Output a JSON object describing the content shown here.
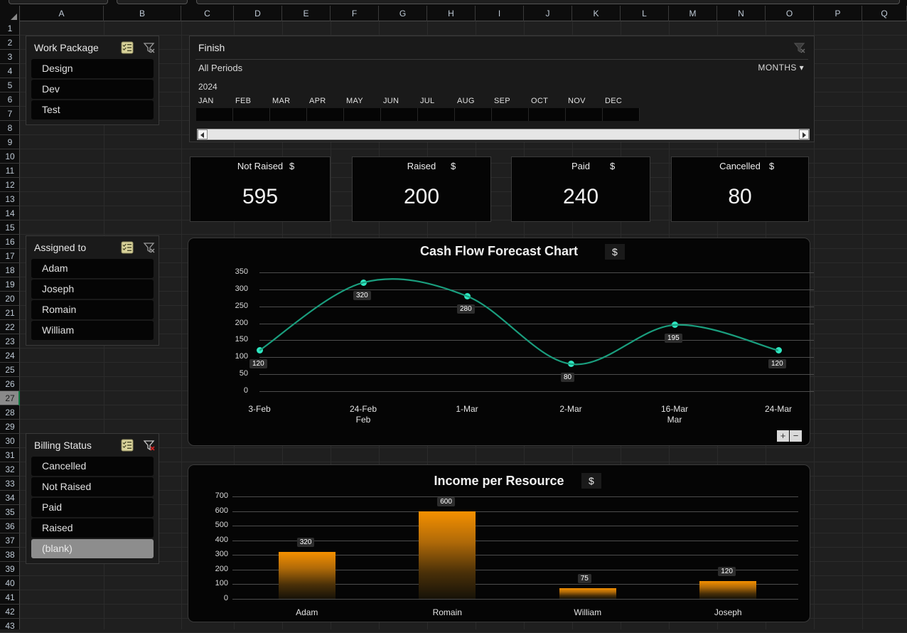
{
  "grid": {
    "columns": [
      "A",
      "B",
      "C",
      "D",
      "E",
      "F",
      "G",
      "H",
      "I",
      "J",
      "K",
      "L",
      "M",
      "N",
      "O",
      "P",
      "Q"
    ],
    "rows": [
      1,
      2,
      3,
      4,
      5,
      6,
      7,
      8,
      9,
      10,
      11,
      12,
      13,
      14,
      15,
      16,
      17,
      18,
      19,
      20,
      21,
      22,
      23,
      24,
      25,
      26,
      27,
      28,
      29,
      30,
      31,
      32,
      33,
      34,
      35,
      36,
      37,
      38,
      39,
      40,
      41,
      42,
      43
    ],
    "active_row": 27
  },
  "slicers": [
    {
      "title": "Work Package",
      "multi_icon": "multi-select-icon",
      "clear_icon": "clear-filter-icon",
      "filter_active": false,
      "items": [
        {
          "label": "Design",
          "state": "normal"
        },
        {
          "label": "Dev",
          "state": "normal"
        },
        {
          "label": "Test",
          "state": "normal"
        }
      ]
    },
    {
      "title": "Assigned to",
      "multi_icon": "multi-select-icon",
      "clear_icon": "clear-filter-icon",
      "filter_active": false,
      "items": [
        {
          "label": "Adam",
          "state": "normal"
        },
        {
          "label": "Joseph",
          "state": "normal"
        },
        {
          "label": "Romain",
          "state": "normal"
        },
        {
          "label": "William",
          "state": "normal"
        }
      ]
    },
    {
      "title": "Billing Status",
      "multi_icon": "multi-select-icon",
      "clear_icon": "clear-filter-icon",
      "filter_active": true,
      "items": [
        {
          "label": "Cancelled",
          "state": "normal"
        },
        {
          "label": "Not Raised",
          "state": "normal"
        },
        {
          "label": "Paid",
          "state": "normal"
        },
        {
          "label": "Raised",
          "state": "normal"
        },
        {
          "label": "(blank)",
          "state": "disabled"
        }
      ]
    }
  ],
  "timeline": {
    "title": "Finish",
    "clear_icon": "clear-filter-icon",
    "period_label": "All Periods",
    "level": "MONTHS",
    "year": "2024",
    "months": [
      "JAN",
      "FEB",
      "MAR",
      "APR",
      "MAY",
      "JUN",
      "JUL",
      "AUG",
      "SEP",
      "OCT",
      "NOV",
      "DEC"
    ],
    "scroll_left_icon": "scroll-left-arrow-icon",
    "scroll_right_icon": "scroll-right-arrow-icon"
  },
  "kpis": [
    {
      "label": "Not Raised",
      "currency": "$",
      "value": "595"
    },
    {
      "label": "Raised",
      "currency": "$",
      "value": "200"
    },
    {
      "label": "Paid",
      "currency": "$",
      "value": "240"
    },
    {
      "label": "Cancelled",
      "currency": "$",
      "value": "80"
    }
  ],
  "chart_data": [
    {
      "type": "line",
      "title": "Cash Flow Forecast Chart",
      "currency": "$",
      "xlabel": "",
      "ylabel": "",
      "ylim": [
        0,
        350
      ],
      "yticks": [
        "0",
        "50",
        "100",
        "150",
        "200",
        "250",
        "300",
        "350"
      ],
      "grid": true,
      "smooth": true,
      "line_color": "#1a9e7e",
      "marker_color": "#2ee6c0",
      "categories": [
        "3-Feb",
        "24-Feb",
        "1-Mar",
        "2-Mar",
        "16-Mar",
        "24-Mar"
      ],
      "group_labels": [
        {
          "label": "Feb",
          "at": "24-Feb"
        },
        {
          "label": "Mar",
          "at": "16-Mar"
        }
      ],
      "values": [
        120,
        320,
        280,
        80,
        195,
        120
      ],
      "zoom_in_label": "+",
      "zoom_out_label": "−"
    },
    {
      "type": "bar",
      "title": "Income per Resource",
      "currency": "$",
      "xlabel": "",
      "ylabel": "",
      "ylim": [
        0,
        700
      ],
      "yticks": [
        "0",
        "100",
        "200",
        "300",
        "400",
        "500",
        "600",
        "700"
      ],
      "grid": true,
      "bar_color_top": "#f59000",
      "bar_color_bottom": "#161208",
      "categories": [
        "Adam",
        "Romain",
        "William",
        "Joseph"
      ],
      "values": [
        320,
        600,
        75,
        120
      ]
    }
  ]
}
